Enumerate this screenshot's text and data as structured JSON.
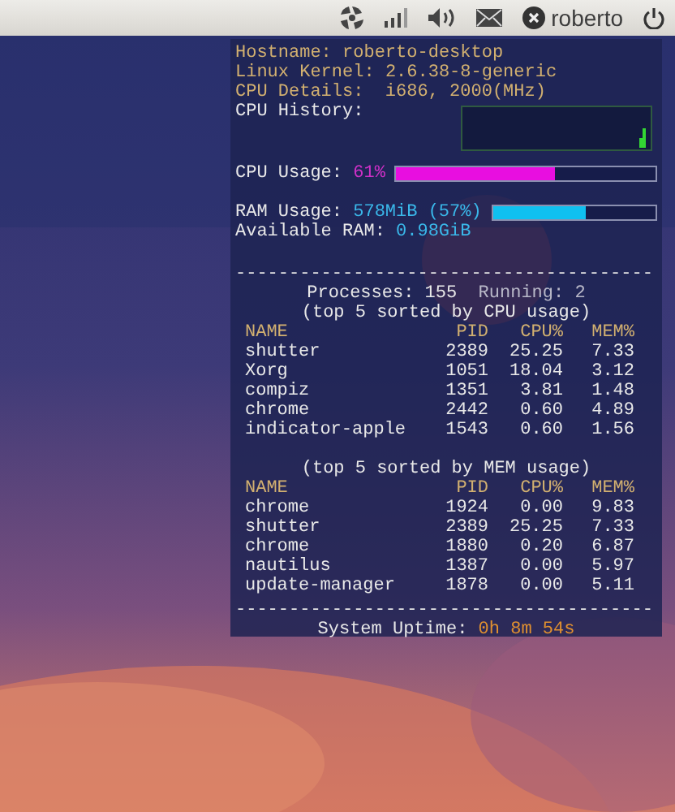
{
  "top_panel": {
    "user": "roberto"
  },
  "system": [
    {
      "label": "Hostname:",
      "value": "roberto-desktop"
    },
    {
      "label": "Linux Kernel:",
      "value": "2.6.38-8-generic"
    },
    {
      "label": "CPU Details:",
      "value": " i686, 2000(MHz)"
    }
  ],
  "cpu_history": {
    "label": "CPU History:"
  },
  "cpu_usage": {
    "label": "CPU Usage:",
    "value": "61%",
    "level": 0.61
  },
  "ram_usage": {
    "label": "RAM Usage:",
    "value": "578MiB (57%)",
    "level": 0.57
  },
  "available_ram": {
    "label": "Available RAM:",
    "value": "0.98GiB"
  },
  "dividers": [
    "---------------------------------------",
    "---------------------------------------"
  ],
  "processes": {
    "total": "Processes: 155",
    "running": "Running: 2"
  },
  "tables": [
    {
      "caption": "(top 5 sorted by CPU usage)",
      "columns": [
        "NAME",
        "PID",
        "CPU%",
        "MEM%"
      ],
      "rows": [
        [
          "shutter",
          "2389",
          "25.25",
          "7.33"
        ],
        [
          "Xorg",
          "1051",
          "18.04",
          "3.12"
        ],
        [
          "compiz",
          "1351",
          "3.81",
          "1.48"
        ],
        [
          "chrome",
          "2442",
          "0.60",
          "4.89"
        ],
        [
          "indicator-apple",
          "1543",
          "0.60",
          "1.56"
        ]
      ]
    },
    {
      "caption": "(top 5 sorted by MEM usage)",
      "columns": [
        "NAME",
        "PID",
        "CPU%",
        "MEM%"
      ],
      "rows": [
        [
          "chrome",
          "1924",
          "0.00",
          "9.83"
        ],
        [
          "shutter",
          "2389",
          "25.25",
          "7.33"
        ],
        [
          "chrome",
          "1880",
          "0.20",
          "6.87"
        ],
        [
          "nautilus",
          "1387",
          "0.00",
          "5.97"
        ],
        [
          "update-manager",
          "1878",
          "0.00",
          "5.11"
        ]
      ]
    }
  ],
  "uptime": {
    "label": "System Uptime:",
    "value": "0h 8m 54s"
  }
}
